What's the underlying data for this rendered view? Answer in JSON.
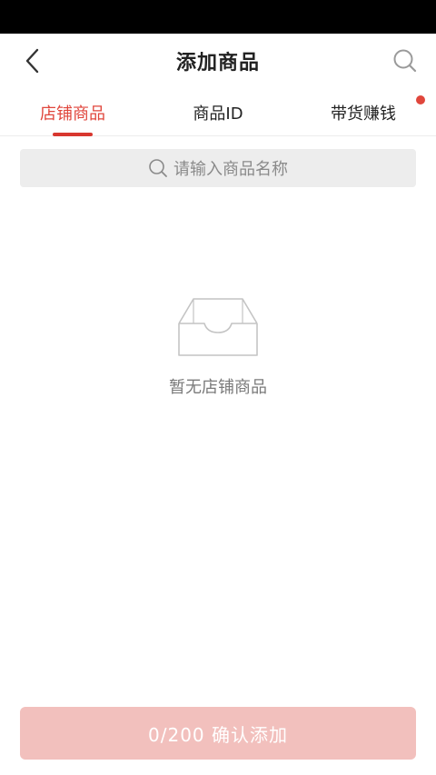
{
  "header": {
    "title": "添加商品",
    "back_icon": "chevron-left-icon",
    "search_icon": "search-icon"
  },
  "tabs": [
    {
      "label": "店铺商品",
      "active": true
    },
    {
      "label": "商品ID",
      "active": false
    },
    {
      "label": "带货赚钱",
      "active": false,
      "badge_dot": true
    }
  ],
  "search": {
    "placeholder": "请输入商品名称"
  },
  "empty_state": {
    "icon": "empty-box-icon",
    "text": "暂无店铺商品"
  },
  "confirm_button": {
    "label": "0/200 确认添加"
  },
  "colors": {
    "accent": "#e0463c",
    "button_disabled": "#f2c0bd",
    "search_bg": "#ededed"
  }
}
